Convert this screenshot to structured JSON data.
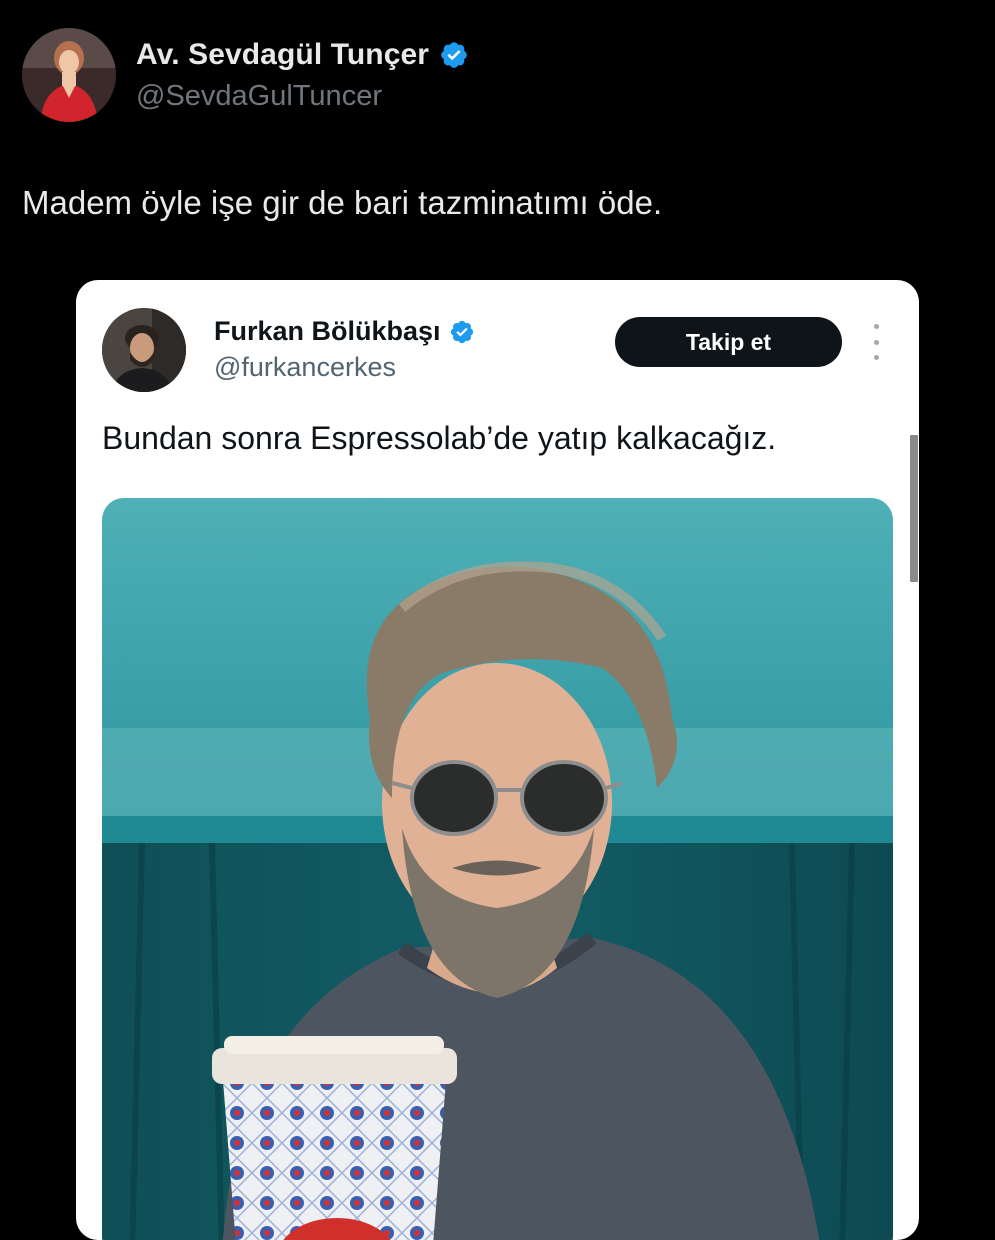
{
  "outer_tweet": {
    "author_name": "Av. Sevdagül Tunçer",
    "author_handle": "@SevdaGulTuncer",
    "verified_icon": "verified-badge-icon",
    "text": "Madem öyle işe gir de bari tazminatımı öde."
  },
  "quoted_screenshot": {
    "author_name": "Furkan Bölükbaşı",
    "author_handle": "@furkancerkes",
    "verified_icon": "verified-badge-icon",
    "follow_label": "Takip et",
    "more_icon": "more-vertical-icon",
    "text": "Bundan sonra Espressolab’de yatıp kalkacağız.",
    "media_icon": "photo-man-with-coffee-cup"
  },
  "colors": {
    "background": "#000000",
    "verified_blue": "#1d9bf0",
    "follow_button": "#0f1419",
    "card_background": "#ffffff",
    "wall_teal": "#3fa7b0"
  }
}
